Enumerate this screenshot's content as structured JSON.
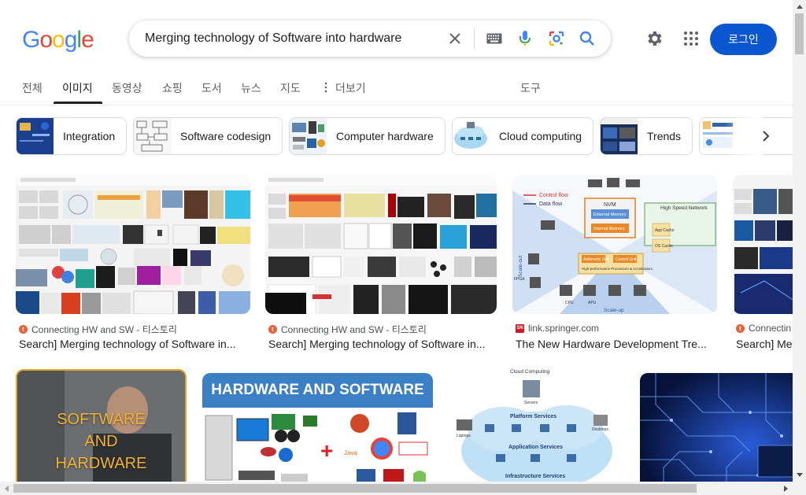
{
  "logo": "Google",
  "search": {
    "query": "Merging technology of Software into hardware"
  },
  "header": {
    "login_label": "로그인"
  },
  "tabs": [
    {
      "label": "전체"
    },
    {
      "label": "이미지"
    },
    {
      "label": "동영상"
    },
    {
      "label": "쇼핑"
    },
    {
      "label": "도서"
    },
    {
      "label": "뉴스"
    },
    {
      "label": "지도"
    },
    {
      "label": "더보기"
    }
  ],
  "tools_label": "도구",
  "chips": [
    {
      "label": "Integration"
    },
    {
      "label": "Software codesign"
    },
    {
      "label": "Computer hardware"
    },
    {
      "label": "Cloud computing"
    },
    {
      "label": "Trends"
    }
  ],
  "results": [
    {
      "source": "Connecting HW and SW - 티스토리",
      "title": "Search] Merging technology of Software in..."
    },
    {
      "source": "Connecting HW and SW - 티스토리",
      "title": "Search] Merging technology of Software in..."
    },
    {
      "source": "link.springer.com",
      "title": "The New Hardware Development Tre..."
    },
    {
      "source": "Connectin",
      "title": "Search] Me"
    }
  ],
  "images_row2": {
    "software_and_hardware": [
      "SOFTWARE",
      "AND",
      "HARDWARE"
    ],
    "hardware_software_banner": "HARDWARE AND SOFTWARE",
    "cloud_diagram": {
      "title": "Cloud Computing",
      "servers": "Servers",
      "platform": "Platform Services",
      "application": "Application Services",
      "infrastructure": "Infrastructure Services",
      "laptops": "Laptops",
      "desktops": "Desktops"
    }
  },
  "springer_diagram": {
    "control_flow": "Control flow",
    "data_flow": "Data flow",
    "nvm": "NVM",
    "external_memory": "External Memory",
    "internal_memory": "Internal Memory",
    "high_speed_network": "High Speed Network",
    "arithmetic_unit": "Arithmetic Unit",
    "control_unit": "Control Unit",
    "processors": "High-performance Processors & Accelerators",
    "app_cache": "App Cache",
    "os_cache": "OS Cache",
    "scale_out": "Scale-out",
    "scale_up": "Scale-up",
    "cpu": "CPU",
    "apu": "APU",
    "fpga": "FPGA"
  },
  "colors": {
    "accent": "#0b57d0",
    "tistory": "#ef5e37",
    "springer_red": "#d11a24"
  }
}
